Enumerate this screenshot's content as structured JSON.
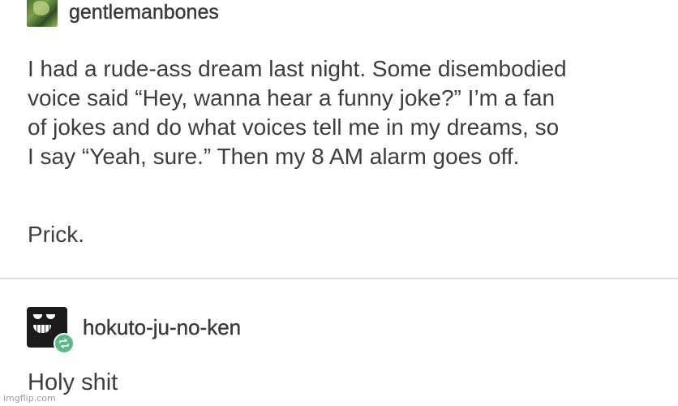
{
  "posts": [
    {
      "username": "gentlemanbones",
      "avatar_icon": "gentlemanbones-avatar",
      "body_lines": [
        "I had a rude-ass dream last night. Some disembodied",
        "voice said “Hey, wanna hear a funny joke?” I’m a fan",
        "of jokes and do what voices tell me in my dreams, so",
        "I say “Yeah, sure.” Then my 8 AM alarm goes off."
      ],
      "closing": "Prick."
    },
    {
      "username": "hokuto-ju-no-ken",
      "avatar_icon": "grinning-face-avatar",
      "badge_icon": "reblog-icon",
      "badge_color": "#5cb88a",
      "body": "Holy shit"
    }
  ],
  "watermark": "imgflip.com"
}
